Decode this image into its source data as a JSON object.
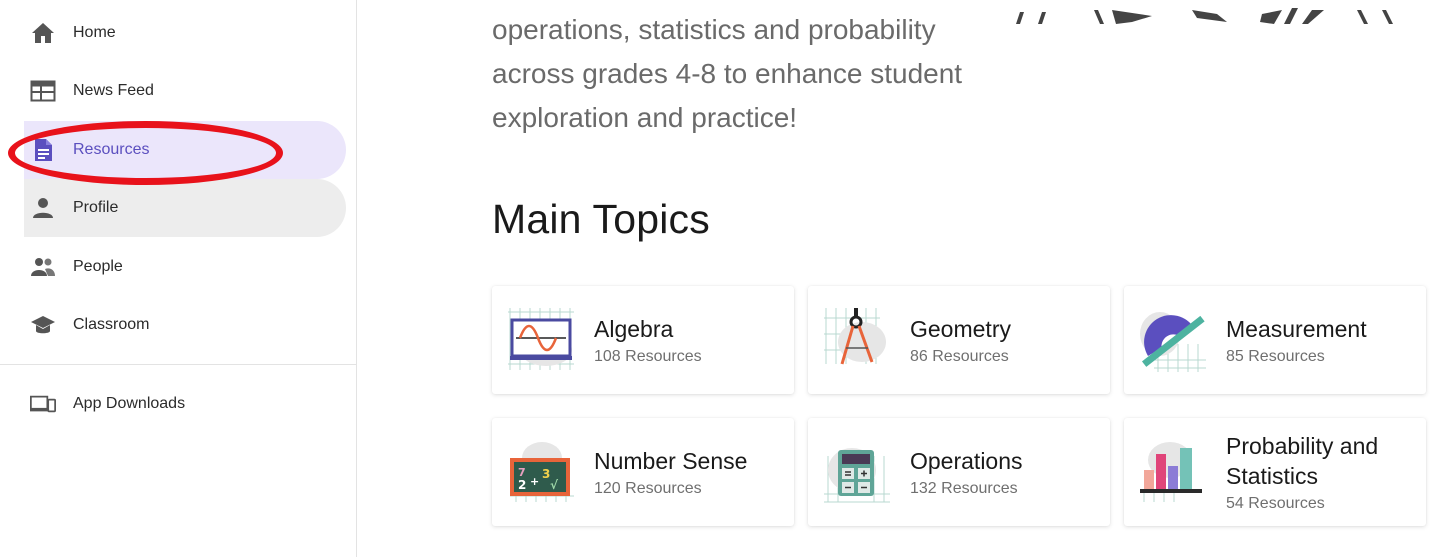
{
  "sidebar": {
    "items": [
      {
        "label": "Home",
        "icon": "home-icon"
      },
      {
        "label": "News Feed",
        "icon": "news-feed-icon"
      },
      {
        "label": "Resources",
        "icon": "resources-icon",
        "active": true
      },
      {
        "label": "Profile",
        "icon": "profile-icon"
      },
      {
        "label": "People",
        "icon": "people-icon"
      },
      {
        "label": "Classroom",
        "icon": "classroom-icon"
      }
    ],
    "secondary": [
      {
        "label": "App Downloads",
        "icon": "app-downloads-icon"
      }
    ]
  },
  "main": {
    "intro": "operations, statistics and probability across grades 4-8 to enhance student exploration and practice!",
    "section_title": "Main Topics",
    "topics": [
      {
        "title": "Algebra",
        "count": "108 Resources",
        "icon": "algebra-graph-icon"
      },
      {
        "title": "Geometry",
        "count": "86 Resources",
        "icon": "compass-icon"
      },
      {
        "title": "Measurement",
        "count": "85 Resources",
        "icon": "protractor-icon"
      },
      {
        "title": "Number Sense",
        "count": "120 Resources",
        "icon": "chalkboard-icon"
      },
      {
        "title": "Operations",
        "count": "132 Resources",
        "icon": "calculator-icon"
      },
      {
        "title": "Probability and Statistics",
        "count": "54 Resources",
        "icon": "bar-chart-icon"
      }
    ]
  },
  "colors": {
    "accent": "#5b4fbf",
    "active_bg": "#ebe6fb",
    "highlight": "#e8121b"
  }
}
